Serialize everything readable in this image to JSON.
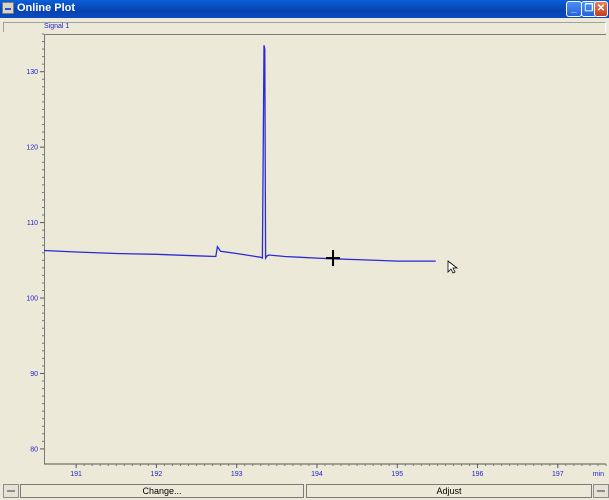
{
  "window": {
    "title": "Online Plot",
    "minimize_glyph": "_",
    "maximize_glyph": "❐",
    "close_glyph": "✕"
  },
  "signal_tab": {
    "label": "Signal 1"
  },
  "buttons": {
    "change_label": "Change...",
    "adjust_label": "Adjust"
  },
  "colors": {
    "trace": "#2b2bd6",
    "axis_text": "#1f1fd0",
    "background": "#ece9d8"
  },
  "icons": {
    "app": "window-app-icon",
    "crosshair": "crosshair-cursor-icon",
    "pointer": "arrow-pointer-icon"
  },
  "chart_data": {
    "type": "line",
    "title": "",
    "xlabel": "",
    "ylabel": "",
    "x_unit": "min",
    "xlim": [
      190.6,
      197.6
    ],
    "ylim": [
      78,
      135
    ],
    "x_ticks": [
      191,
      192,
      193,
      194,
      195,
      196,
      197
    ],
    "y_ticks": [
      80,
      90,
      100,
      110,
      120,
      130
    ],
    "grid": false,
    "series": [
      {
        "x": [
          190.6,
          191.0,
          191.5,
          192.0,
          192.5,
          192.74,
          192.76,
          192.8,
          193.0,
          193.3,
          193.32,
          193.34,
          193.35,
          193.36,
          193.38,
          193.4,
          193.6,
          193.8,
          194.0,
          194.2,
          194.5,
          195.0,
          195.48
        ],
        "y": [
          106.3,
          106.1,
          105.9,
          105.8,
          105.6,
          105.5,
          106.8,
          106.2,
          105.9,
          105.4,
          105.3,
          133.5,
          133.0,
          105.3,
          105.6,
          105.7,
          105.5,
          105.4,
          105.3,
          105.2,
          105.1,
          104.9,
          104.9
        ]
      }
    ],
    "cursor_position": {
      "x": 194.2,
      "y": 105.3
    }
  }
}
